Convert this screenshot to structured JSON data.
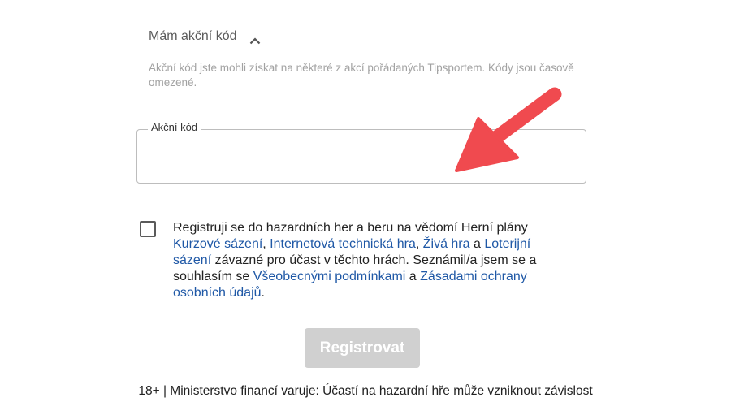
{
  "promo": {
    "toggle_label": "Mám akční kód",
    "toggle_icon": "chevron-up-icon",
    "description": "Akční kód jste mohli získat na některé z akcí pořádaných Tipsportem. Kódy jsou časově omezené."
  },
  "promo_field": {
    "label": "Akční kód",
    "value": ""
  },
  "consent": {
    "checked": false,
    "t1": "Registruji se do hazardních her a beru na vědomí Herní plány ",
    "l1": "Kurzové sázení",
    "t2": ", ",
    "l2": "Internetová technická hra",
    "t3": ", ",
    "l3": "Živá hra",
    "t4": " a ",
    "l4": "Loterijní sázení",
    "t5": " závazné pro účast v těchto hrách. Seznámil/a jsem se a souhlasím se ",
    "l5": "Všeobecnými podmínkami",
    "t6": " a ",
    "l6": "Zásadami ochrany osobních údajů",
    "t7": "."
  },
  "register_button": {
    "label": "Registrovat",
    "disabled": true
  },
  "footer": {
    "warning": "18+ | Ministerstvo financí varuje: Účastí na hazardní hře může vzniknout závislost"
  },
  "annotation": {
    "icon": "red-arrow-icon",
    "color": "#f04a4f"
  }
}
